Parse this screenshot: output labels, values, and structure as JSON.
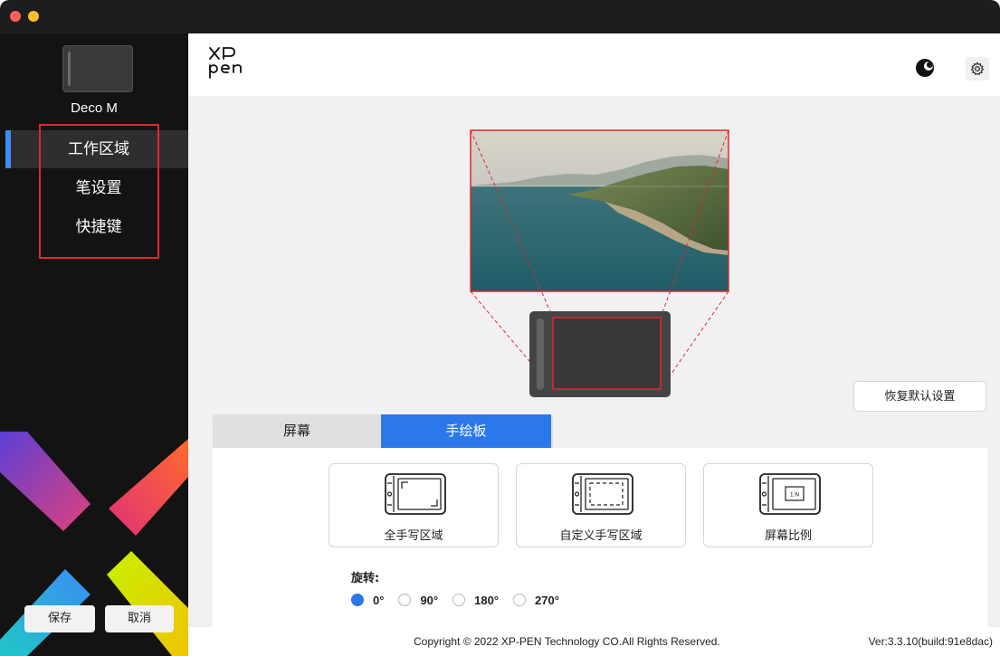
{
  "sidebar": {
    "device_name": "Deco M",
    "nav_items": [
      {
        "label": "工作区域",
        "active": true
      },
      {
        "label": "笔设置",
        "active": false
      },
      {
        "label": "快捷键",
        "active": false
      }
    ],
    "save_label": "保存",
    "cancel_label": "取消"
  },
  "header": {
    "logo_text": "XP pen"
  },
  "main": {
    "reset_label": "恢复默认设置",
    "tabs": [
      {
        "label": "屏幕",
        "active": false
      },
      {
        "label": "手绘板",
        "active": true
      }
    ],
    "modes": [
      {
        "label": "全手写区域",
        "icon": "full-area-icon"
      },
      {
        "label": "自定义手写区域",
        "icon": "custom-area-icon"
      },
      {
        "label": "屏幕比例",
        "icon": "screen-ratio-icon"
      }
    ],
    "screen_ratio_icon_text": "1:N",
    "rotation_label": "旋转:",
    "rotation_options": [
      {
        "label": "0°",
        "selected": true
      },
      {
        "label": "90°",
        "selected": false
      },
      {
        "label": "180°",
        "selected": false
      },
      {
        "label": "270°",
        "selected": false
      }
    ]
  },
  "footer": {
    "copyright": "Copyright © 2022  XP-PEN Technology CO.All Rights Reserved.",
    "version": "Ver:3.3.10(build:91e8dac)"
  },
  "colors": {
    "accent": "#2a78ea",
    "highlight_red": "#e3262c",
    "sidebar_bg": "#131313"
  }
}
